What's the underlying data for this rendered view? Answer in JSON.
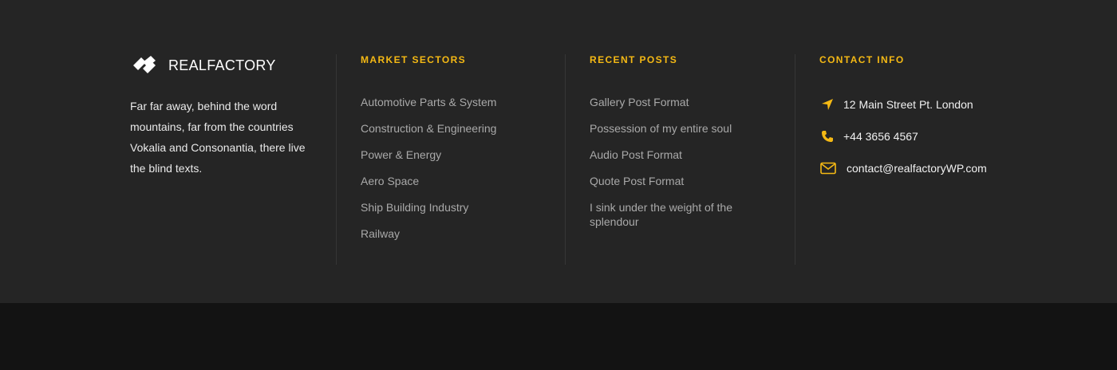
{
  "brand": {
    "name": "REALFACTORY",
    "accent": "#f5b914"
  },
  "about": {
    "text": "Far far away, behind the word mountains, far from the countries Vokalia and Consonantia, there live the blind texts."
  },
  "sectors": {
    "title": "MARKET SECTORS",
    "items": [
      "Automotive Parts & System",
      "Construction & Engineering",
      "Power & Energy",
      "Aero Space",
      "Ship Building Industry",
      "Railway"
    ]
  },
  "posts": {
    "title": "RECENT POSTS",
    "items": [
      "Gallery Post Format",
      "Possession of my entire soul",
      "Audio Post Format",
      "Quote Post Format",
      "I sink under the weight of the splendour"
    ]
  },
  "contact": {
    "title": "CONTACT INFO",
    "address": "12 Main Street Pt. London",
    "phone": "+44 3656 4567",
    "email": "contact@realfactoryWP.com",
    "icons": [
      "location-arrow-icon",
      "phone-icon",
      "envelope-icon"
    ]
  }
}
